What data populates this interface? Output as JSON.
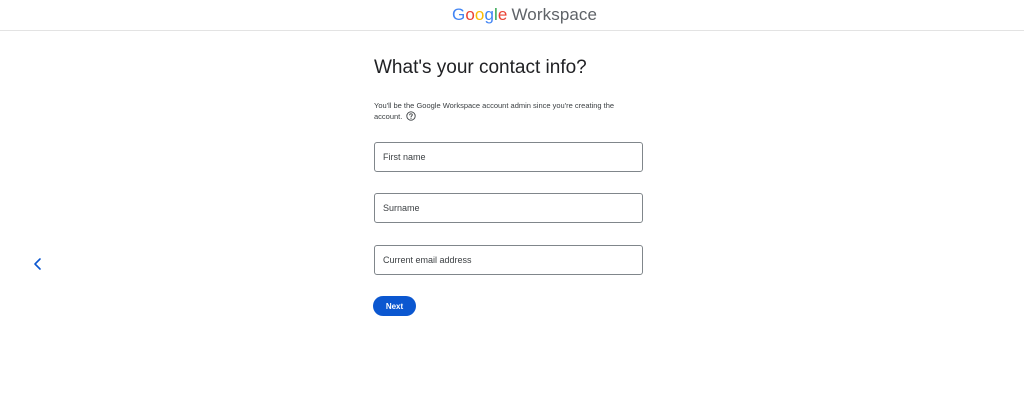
{
  "header": {
    "logo_letters": {
      "g1": "G",
      "o1": "o",
      "o2": "o",
      "g2": "g",
      "l": "l",
      "e": "e"
    },
    "logo_product": "Workspace",
    "brand_colors": {
      "blue": "#4285F4",
      "red": "#EA4335",
      "yellow": "#FBBC05",
      "green": "#34A853"
    }
  },
  "nav": {
    "back_icon": "chevron-left-icon"
  },
  "form": {
    "title": "What's your contact info?",
    "subtitle": "You'll be the Google Workspace account admin since you're creating the account.",
    "help_icon": "help-circle-icon",
    "first_name": {
      "value": "",
      "placeholder": "First name"
    },
    "surname": {
      "value": "",
      "placeholder": "Surname"
    },
    "email": {
      "value": "",
      "placeholder": "Current email address"
    },
    "next_label": "Next",
    "accent_color": "#0b57d0"
  }
}
